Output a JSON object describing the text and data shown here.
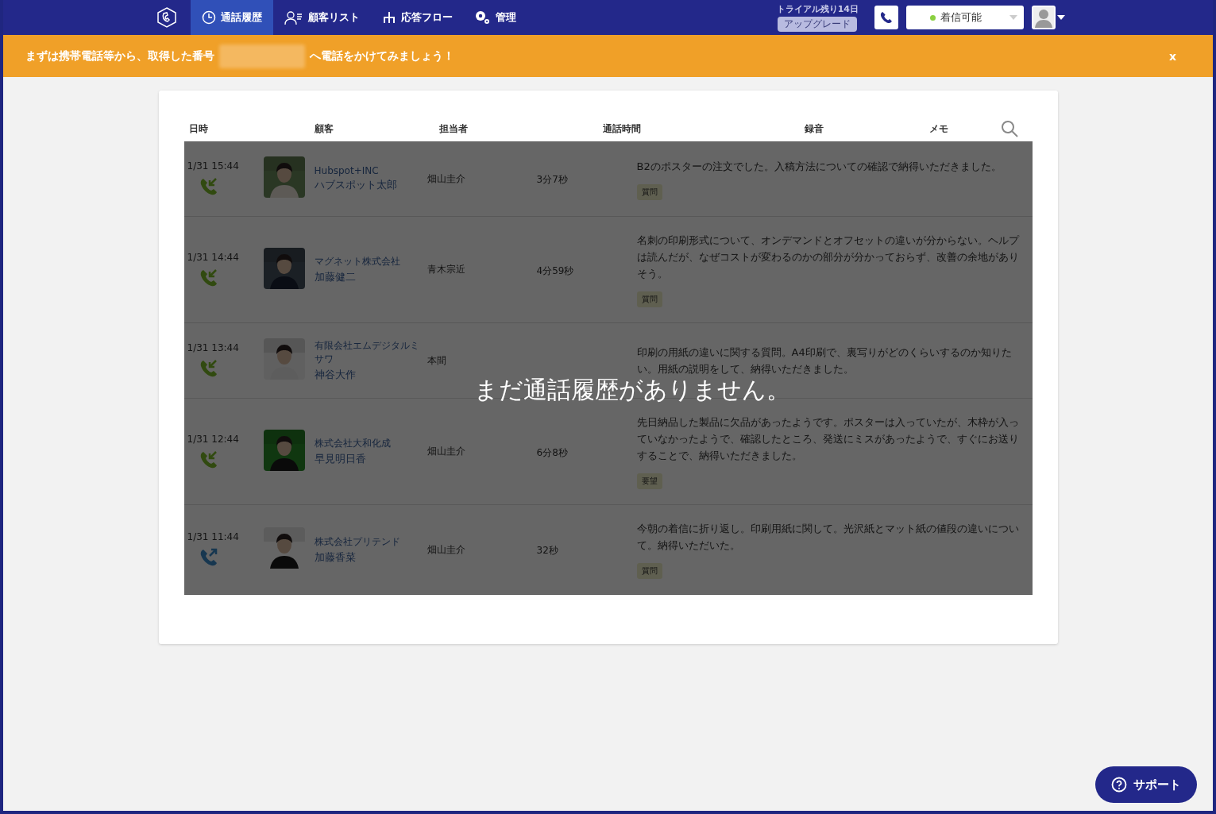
{
  "nav": {
    "items": [
      {
        "label": "通話履歴",
        "selected": true
      },
      {
        "label": "顧客リスト",
        "selected": false
      },
      {
        "label": "応答フロー",
        "selected": false
      },
      {
        "label": "管理",
        "selected": false
      }
    ],
    "trial": "トライアル残り14日",
    "upgrade": "アップグレード",
    "status": "着信可能"
  },
  "banner": {
    "before": "まずは携帯電話等から、取得した番号",
    "after": "へ電話をかけてみましょう！",
    "close": "x"
  },
  "table": {
    "columns": [
      "日時",
      "顧客",
      "担当者",
      "通話時間",
      "録音",
      "メモ"
    ],
    "rows": [
      {
        "time": "1/31 15:44",
        "kind": "incoming",
        "company": "Hubspot+INC",
        "name": "ハブスポット太郎",
        "agent": "畑山圭介",
        "duration": "3分7秒",
        "memo": "B2のポスターの注文でした。入稿方法についての確認で納得いただきました。",
        "tag": "質問"
      },
      {
        "time": "1/31 14:44",
        "kind": "incoming",
        "company": "マグネット株式会社",
        "name": "加藤健二",
        "agent": "青木宗近",
        "duration": "4分59秒",
        "memo": "名刺の印刷形式について、オンデマンドとオフセットの違いが分からない。ヘルプは読んだが、なぜコストが変わるのかの部分が分かっておらず、改善の余地がありそう。",
        "tag": "質問"
      },
      {
        "time": "1/31 13:44",
        "kind": "incoming",
        "company": "有限会社エムデジタルミサワ",
        "name": "神谷大作",
        "agent": "本間",
        "memo": "印刷の用紙の違いに関する質問。A4印刷で、裏写りがどのくらいするのか知りたい。用紙の説明をして、納得いただきました。"
      },
      {
        "time": "1/31 12:44",
        "kind": "incoming",
        "company": "株式会社大和化成",
        "name": "早見明日香",
        "agent": "畑山圭介",
        "duration": "6分8秒",
        "memo": "先日納品した製品に欠品があったようです。ポスターは入っていたが、木枠が入っていなかったようで、確認したところ、発送にミスがあったようで、すぐにお送りすることで、納得いただきました。",
        "tag": "要望"
      },
      {
        "time": "1/31 11:44",
        "kind": "outgoing",
        "company": "株式会社プリテンド",
        "name": "加藤香菜",
        "agent": "畑山圭介",
        "duration": "32秒",
        "memo": "今朝の着信に折り返し。印刷用紙に関して。光沢紙とマット紙の値段の違いについて。納得いただいた。",
        "tag": "質問"
      }
    ],
    "empty_message": "まだ通話履歴がありません。"
  },
  "support": "サポート"
}
